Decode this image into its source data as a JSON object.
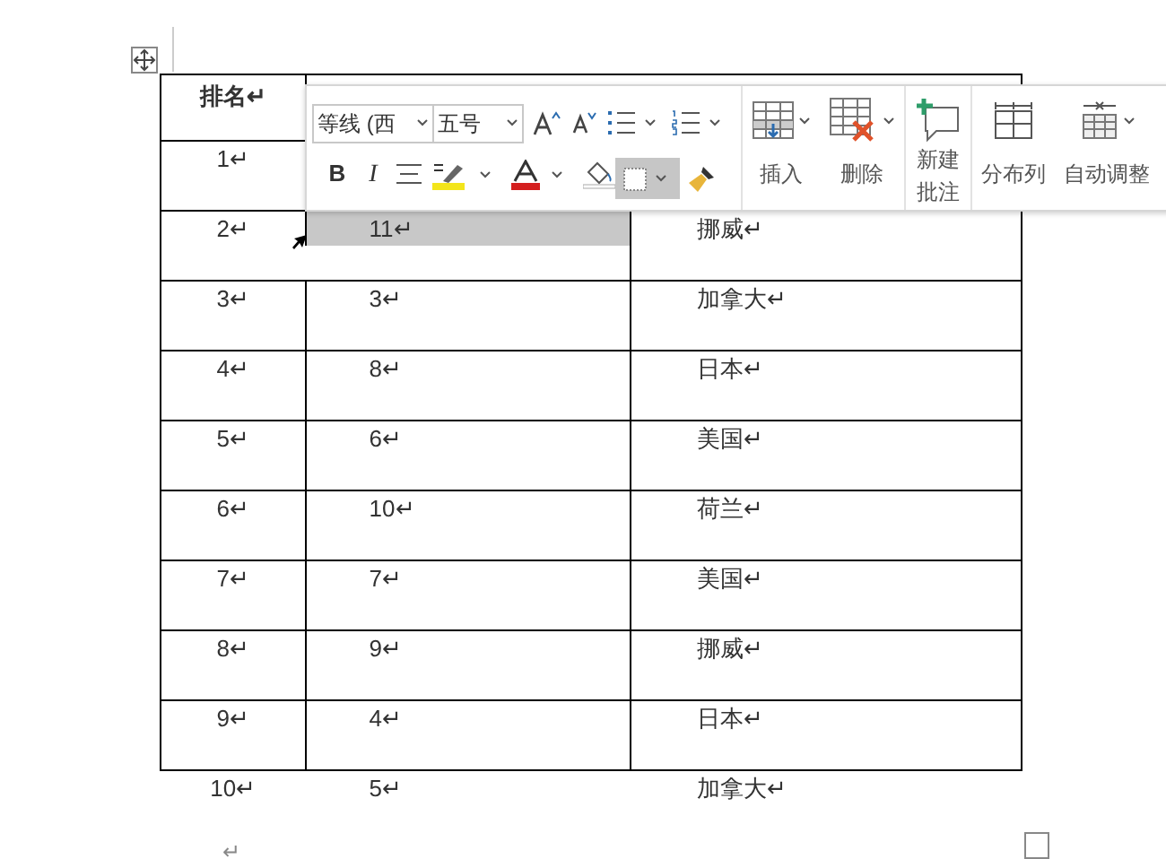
{
  "table": {
    "header": [
      "排名↵"
    ],
    "rows": [
      {
        "kind": "bordered",
        "cells": [
          {
            "text": "1↵",
            "selected": false
          }
        ]
      },
      {
        "kind": "bordered",
        "cells": [
          {
            "text": "2↵",
            "selected": false
          },
          {
            "text": "11↵",
            "selected": true
          },
          {
            "text": "挪威↵",
            "selected": false
          }
        ]
      },
      {
        "kind": "bordered",
        "cells": [
          {
            "text": "3↵",
            "selected": false
          },
          {
            "text": "3↵",
            "selected": false
          },
          {
            "text": "加拿大↵",
            "selected": false
          }
        ]
      },
      {
        "kind": "bordered",
        "cells": [
          {
            "text": "4↵",
            "selected": false
          },
          {
            "text": "8↵",
            "selected": false
          },
          {
            "text": "日本↵",
            "selected": false
          }
        ]
      },
      {
        "kind": "bordered",
        "cells": [
          {
            "text": "5↵",
            "selected": false
          },
          {
            "text": "6↵",
            "selected": false
          },
          {
            "text": "美国↵",
            "selected": false
          }
        ]
      },
      {
        "kind": "bordered",
        "cells": [
          {
            "text": "6↵",
            "selected": false
          },
          {
            "text": "10↵",
            "selected": false
          },
          {
            "text": "荷兰↵",
            "selected": false
          }
        ]
      },
      {
        "kind": "bordered",
        "cells": [
          {
            "text": "7↵",
            "selected": false
          },
          {
            "text": "7↵",
            "selected": false
          },
          {
            "text": "美国↵",
            "selected": false
          }
        ]
      },
      {
        "kind": "bordered",
        "cells": [
          {
            "text": "8↵",
            "selected": false
          },
          {
            "text": "9↵",
            "selected": false
          },
          {
            "text": "挪威↵",
            "selected": false
          }
        ]
      },
      {
        "kind": "bordered",
        "cells": [
          {
            "text": "9↵",
            "selected": false
          },
          {
            "text": "4↵",
            "selected": false
          },
          {
            "text": "日本↵",
            "selected": false
          }
        ]
      },
      {
        "kind": "plain",
        "cells": [
          {
            "text": "10↵",
            "selected": false
          },
          {
            "text": "5↵",
            "selected": false
          },
          {
            "text": "加拿大↵",
            "selected": false
          }
        ]
      }
    ]
  },
  "after_table": "↵",
  "toolbar": {
    "font": "等线 (西",
    "size": "五号",
    "bold": "B",
    "italic": "I",
    "borders": {
      "selected": true
    },
    "actions": [
      {
        "kind": "insert",
        "label": "插入"
      },
      {
        "kind": "delete",
        "label": "删除"
      },
      {
        "kind": "comment",
        "label": "新建批注"
      },
      {
        "kind": "distribute",
        "label": "分布列"
      },
      {
        "kind": "autofit",
        "label": "自动调整"
      }
    ]
  }
}
